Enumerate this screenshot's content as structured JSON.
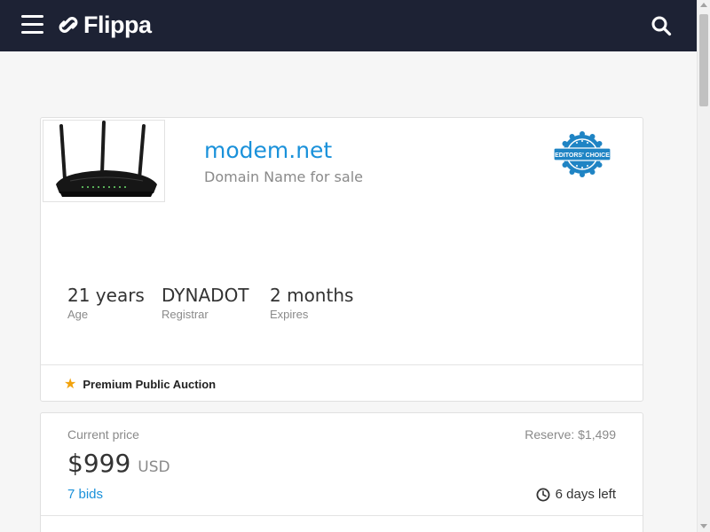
{
  "header": {
    "logo_text": "Flippa",
    "menu_icon": "hamburger-icon",
    "search_icon": "search-icon",
    "background": "#1d2234"
  },
  "listing": {
    "title": "modem.net",
    "subtitle": "Domain Name for sale",
    "thumbnail_alt": "router image",
    "badge_text": "EDITORS' CHOICE",
    "badge_icon": "editors-choice-badge-icon",
    "stats": [
      {
        "value": "21 years",
        "label": "Age"
      },
      {
        "value": "DYNADOT",
        "label": "Registrar"
      },
      {
        "value": "2 months",
        "label": "Expires"
      }
    ],
    "auction_type": "Premium Public Auction",
    "auction_icon": "star-icon"
  },
  "pricing": {
    "current_label": "Current price",
    "reserve": "Reserve: $1,499",
    "price": "$999",
    "currency": "USD",
    "bids": "7 bids",
    "time_left": "6 days left",
    "time_icon": "clock-icon"
  },
  "colors": {
    "accent": "#1a91da",
    "star": "#f2a20c",
    "badge": "#1f84c4"
  }
}
